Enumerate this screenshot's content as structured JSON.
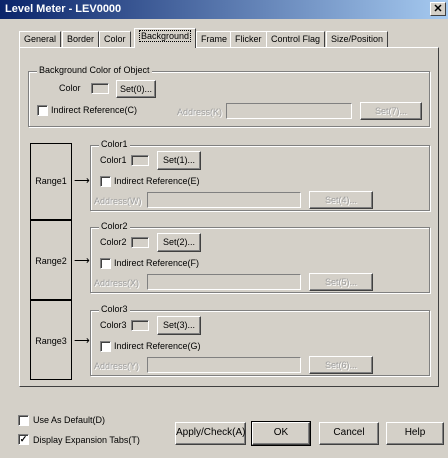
{
  "window": {
    "title": "Level Meter - LEV0000",
    "close_glyph": "✕"
  },
  "tabs": [
    {
      "label": "General"
    },
    {
      "label": "Border"
    },
    {
      "label": "Color"
    },
    {
      "label": "Background"
    },
    {
      "label": "Frame"
    },
    {
      "label": "Flicker"
    },
    {
      "label": "Control Flag"
    },
    {
      "label": "Size/Position"
    }
  ],
  "background_group": {
    "title": "Background Color of Object",
    "color_label": "Color",
    "set_button": "Set(0)...",
    "indirect_label": "Indirect Reference(C)",
    "address_label": "Address(K)",
    "address_value": "",
    "set_address_button": "Set(7)..."
  },
  "ranges": [
    {
      "range_label": "Range1",
      "group_title": "Color1",
      "color_label": "Color1",
      "set_button": "Set(1)...",
      "indirect_label": "Indirect Reference(E)",
      "address_label": "Address(W)",
      "address_value": "",
      "set_address_button": "Set(4)..."
    },
    {
      "range_label": "Range2",
      "group_title": "Color2",
      "color_label": "Color2",
      "set_button": "Set(2)...",
      "indirect_label": "Indirect Reference(F)",
      "address_label": "Address(X)",
      "address_value": "",
      "set_address_button": "Set(5)..."
    },
    {
      "range_label": "Range3",
      "group_title": "Color3",
      "color_label": "Color3",
      "set_button": "Set(3)...",
      "indirect_label": "Indirect Reference(G)",
      "address_label": "Address(Y)",
      "address_value": "",
      "set_address_button": "Set(6)..."
    }
  ],
  "footer": {
    "use_as_default": "Use As Default(D)",
    "display_expansion_tabs": "Display Expansion Tabs(T)",
    "display_expansion_checked_glyph": "✓",
    "apply_check": "Apply/Check(A)",
    "ok": "OK",
    "cancel": "Cancel",
    "help": "Help"
  }
}
